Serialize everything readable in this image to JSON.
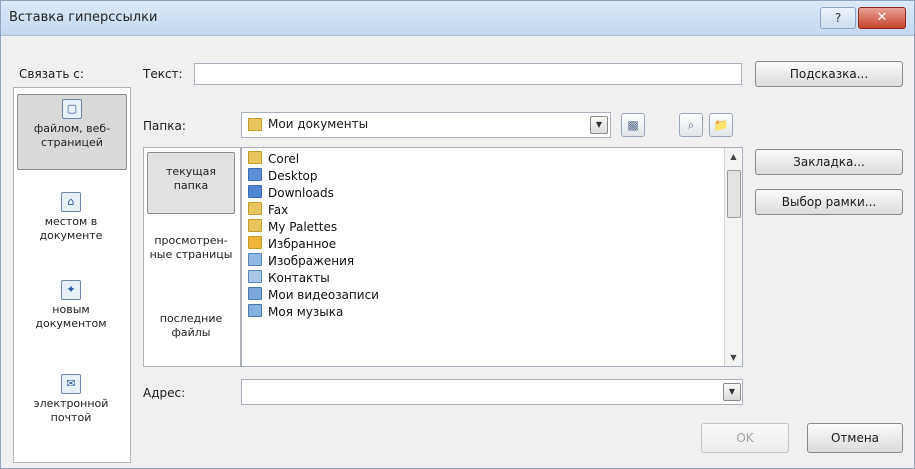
{
  "window": {
    "title": "Вставка гиперссылки",
    "help_glyph": "?",
    "close_glyph": "✕"
  },
  "link_to": {
    "label": "Связать с:",
    "items": [
      {
        "label": "файлом, веб-страницей",
        "icon": "web-page-icon",
        "selected": true
      },
      {
        "label": "местом в документе",
        "icon": "bookmark-icon",
        "selected": false
      },
      {
        "label": "новым документом",
        "icon": "new-document-icon",
        "selected": false
      },
      {
        "label": "электронной почтой",
        "icon": "email-icon",
        "selected": false
      }
    ]
  },
  "text_field": {
    "label": "Текст:",
    "value": ""
  },
  "folder": {
    "label": "Папка:",
    "value": "Мои документы"
  },
  "look_in": {
    "items": [
      {
        "label": "текущая папка",
        "selected": true
      },
      {
        "label": "просмотрен-ные страницы",
        "selected": false
      },
      {
        "label": "последние файлы",
        "selected": false
      }
    ]
  },
  "files": [
    {
      "name": "Corel",
      "icon": "folder-icon"
    },
    {
      "name": "Desktop",
      "icon": "desktop-folder-icon"
    },
    {
      "name": "Downloads",
      "icon": "downloads-folder-icon"
    },
    {
      "name": "Fax",
      "icon": "folder-icon"
    },
    {
      "name": "My Palettes",
      "icon": "folder-icon"
    },
    {
      "name": "Избранное",
      "icon": "favorites-folder-icon"
    },
    {
      "name": "Изображения",
      "icon": "pictures-folder-icon"
    },
    {
      "name": "Контакты",
      "icon": "contacts-folder-icon"
    },
    {
      "name": "Мои видеозаписи",
      "icon": "videos-folder-icon"
    },
    {
      "name": "Моя музыка",
      "icon": "music-folder-icon"
    }
  ],
  "address": {
    "label": "Адрес:",
    "value": ""
  },
  "buttons": {
    "hint": "Подсказка...",
    "bookmark": "Закладка...",
    "frame": "Выбор рамки...",
    "ok": "OK",
    "cancel": "Отмена"
  }
}
